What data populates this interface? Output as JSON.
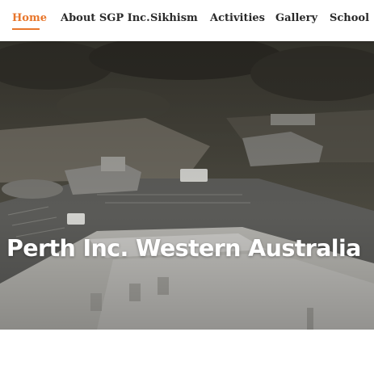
{
  "nav": {
    "items": [
      {
        "label": "Home",
        "active": true
      },
      {
        "label": "About SGP Inc.",
        "active": false
      },
      {
        "label": "Sikhism",
        "active": false
      },
      {
        "label": "Activities",
        "active": false
      },
      {
        "label": "Gallery",
        "active": false
      },
      {
        "label": "School",
        "active": false
      }
    ]
  },
  "hero": {
    "title": "Perth Inc. Western Australia"
  },
  "colors": {
    "accent": "#e8762b",
    "nav_text": "#2a2a2a",
    "hero_text": "#ffffff"
  }
}
